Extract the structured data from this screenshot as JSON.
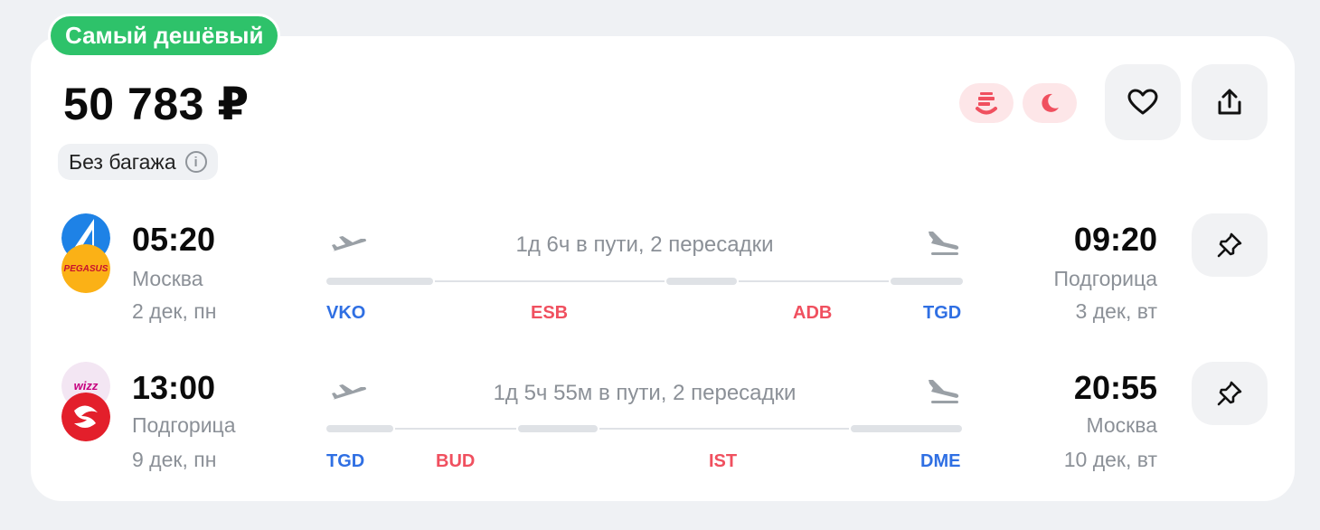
{
  "badge": "Самый дешёвый",
  "price": "50 783 ₽",
  "baggage": "Без багажа",
  "colors": {
    "badge": "#2ec26a",
    "airport_blue": "#2f6fe3",
    "airport_red": "#f0505f",
    "pill_bg": "#fde6e8"
  },
  "icons": [
    "luggage-warning-icon",
    "night-moon-icon",
    "heart-icon",
    "share-icon",
    "pin-icon",
    "takeoff-icon",
    "landing-icon",
    "info-icon"
  ],
  "outbound": {
    "airlines": [
      "Аэрофлот",
      "Pegasus"
    ],
    "dep_time": "05:20",
    "dep_city": "Москва",
    "dep_date": "2 дек, пн",
    "duration": "1д 6ч в пути, 2 пересадки",
    "arr_time": "09:20",
    "arr_city": "Подгорица",
    "arr_date": "3 дек, вт",
    "airports": [
      "VKO",
      "ESB",
      "ADB",
      "TGD"
    ]
  },
  "return": {
    "airlines": [
      "Wizz",
      "Air Serbia"
    ],
    "dep_time": "13:00",
    "dep_city": "Подгорица",
    "dep_date": "9 дек, пн",
    "duration": "1д 5ч 55м в пути, 2 пересадки",
    "arr_time": "20:55",
    "arr_city": "Москва",
    "arr_date": "10 дек, вт",
    "airports": [
      "TGD",
      "BUD",
      "IST",
      "DME"
    ]
  }
}
